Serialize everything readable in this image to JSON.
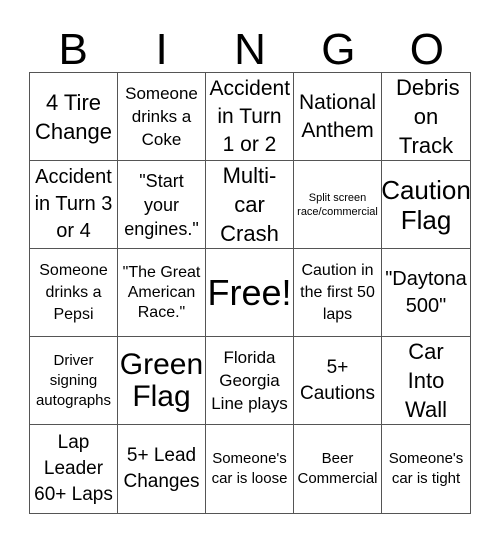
{
  "header": {
    "letters": [
      "B",
      "I",
      "N",
      "G",
      "O"
    ]
  },
  "cells": [
    "4 Tire Change",
    "Someone drinks a Coke",
    "Accident in Turn 1 or 2",
    "National Anthem",
    "Debris on Track",
    "Accident in Turn 3 or 4",
    "\"Start your engines.\"",
    "Multi-car Crash",
    "Split screen race/commercial",
    "Caution Flag",
    "Someone drinks a Pepsi",
    "\"The Great American Race.\"",
    "Free!",
    "Caution in the first 50 laps",
    "\"Daytona 500\"",
    "Driver signing autographs",
    "Green Flag",
    "Florida Georgia Line plays",
    "5+ Cautions",
    "Car Into Wall",
    "Lap Leader 60+ Laps",
    "5+ Lead Changes",
    "Someone's car is loose",
    "Beer Commercial",
    "Someone's car is tight"
  ]
}
